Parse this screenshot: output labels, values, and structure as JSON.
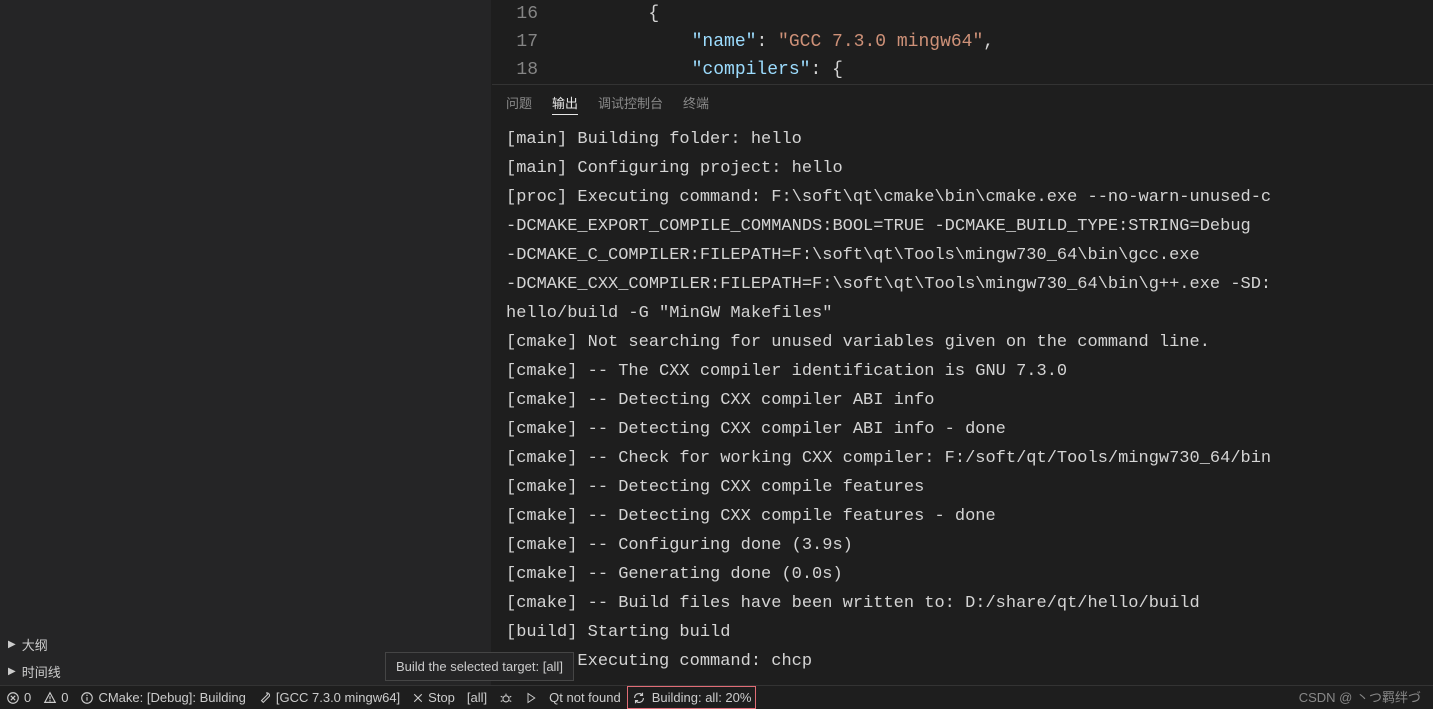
{
  "sidebar": {
    "outline": "大纲",
    "timeline": "时间线"
  },
  "editor": {
    "lines": [
      {
        "num": "16",
        "indent": "        ",
        "tokens": [
          {
            "t": "brace",
            "v": "{"
          }
        ]
      },
      {
        "num": "17",
        "indent": "            ",
        "tokens": [
          {
            "t": "key",
            "v": "\"name\""
          },
          {
            "t": "punct",
            "v": ": "
          },
          {
            "t": "string",
            "v": "\"GCC 7.3.0 mingw64\""
          },
          {
            "t": "punct",
            "v": ","
          }
        ]
      },
      {
        "num": "18",
        "indent": "            ",
        "tokens": [
          {
            "t": "key",
            "v": "\"compilers\""
          },
          {
            "t": "punct",
            "v": ": "
          },
          {
            "t": "brace",
            "v": "{"
          }
        ]
      }
    ]
  },
  "panel": {
    "tabs": {
      "problems": "问题",
      "output": "输出",
      "debug": "调试控制台",
      "terminal": "终端"
    },
    "output": "[main] Building folder: hello\n[main] Configuring project: hello \n[proc] Executing command: F:\\soft\\qt\\cmake\\bin\\cmake.exe --no-warn-unused-c\n-DCMAKE_EXPORT_COMPILE_COMMANDS:BOOL=TRUE -DCMAKE_BUILD_TYPE:STRING=Debug\n-DCMAKE_C_COMPILER:FILEPATH=F:\\soft\\qt\\Tools\\mingw730_64\\bin\\gcc.exe\n-DCMAKE_CXX_COMPILER:FILEPATH=F:\\soft\\qt\\Tools\\mingw730_64\\bin\\g++.exe -SD:\nhello/build -G \"MinGW Makefiles\"\n[cmake] Not searching for unused variables given on the command line.\n[cmake] -- The CXX compiler identification is GNU 7.3.0\n[cmake] -- Detecting CXX compiler ABI info\n[cmake] -- Detecting CXX compiler ABI info - done\n[cmake] -- Check for working CXX compiler: F:/soft/qt/Tools/mingw730_64/bin\n[cmake] -- Detecting CXX compile features\n[cmake] -- Detecting CXX compile features - done\n[cmake] -- Configuring done (3.9s)\n[cmake] -- Generating done (0.0s)\n[cmake] -- Build files have been written to: D:/share/qt/hello/build\n[build] Starting build\n[proc] Executing command: chcp"
  },
  "status": {
    "errors": "0",
    "warnings": "0",
    "cmake": "CMake: [Debug]: Building",
    "kit": "[GCC 7.3.0 mingw64]",
    "stop": "Stop",
    "target": "[all]",
    "qt": "Qt not found",
    "building": "Building: all: 20%"
  },
  "tooltip": "Build the selected target: [all]",
  "watermark": "CSDN @ 丶つ羁绊づ"
}
